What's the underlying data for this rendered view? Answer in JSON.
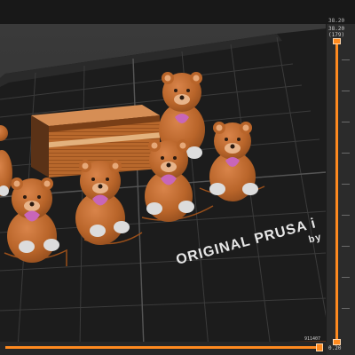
{
  "top_ruler": {
    "value": "38.20"
  },
  "vertical_slider": {
    "top_value": "38.20",
    "top_sub": "(179)",
    "bottom_value": "0.20",
    "bottom_sub": "(1)",
    "level": 1.0
  },
  "horizontal_slider": {
    "value": "911407",
    "level": 1.0
  },
  "bed": {
    "brand_text": "ORIGINAL PRUSA i",
    "brand_sub": "by"
  },
  "colors": {
    "accent": "#ff8a1f",
    "bear": "#c06a2c",
    "heart": "#c866b8",
    "bed": "#1f1f1f",
    "bed_edge": "#b44a0e"
  }
}
